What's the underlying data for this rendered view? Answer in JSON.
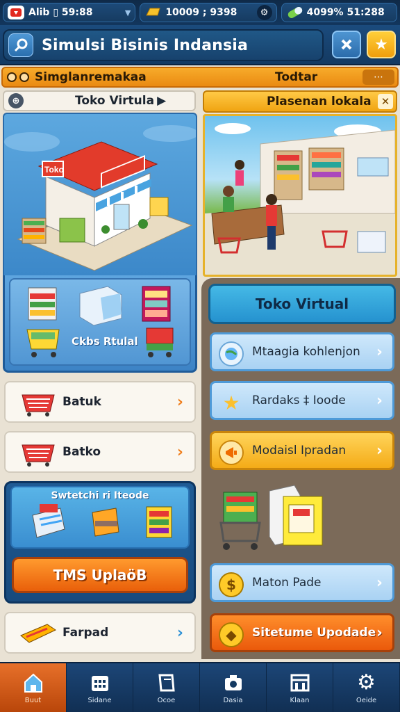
{
  "status": {
    "stat1": "Alib ▯ 59:88",
    "stat2": "10009 ; 9398",
    "stat3": "4099% 51:288"
  },
  "header": {
    "title": "Simulsi Bisinis Indansia"
  },
  "banner": {
    "left_label": "Simglanremakaa",
    "center_label": "Todtar"
  },
  "left": {
    "tab_label": "Toko Virtula",
    "panel_caption": "Ckbs Rtulal",
    "list": [
      {
        "label": "Batuk"
      },
      {
        "label": "Batko"
      }
    ],
    "feature_title": "Swtetchi ri Iteode",
    "feature_button": "TMS UplaöB",
    "last_item": "Farpad"
  },
  "right": {
    "tab_label": "Plasenan lokala",
    "main_button": "Toko Virtual",
    "buttons": [
      {
        "label": "Mtaagia kohlenjon"
      },
      {
        "label": "Rardaks ‡ Ioode"
      },
      {
        "label": "Modaisl Ipradan"
      },
      {
        "label": "Maton Pade"
      },
      {
        "label": "Sitetume Upodade"
      }
    ]
  },
  "nav": {
    "items": [
      {
        "label": "Buut"
      },
      {
        "label": "Sidane"
      },
      {
        "label": "Ocoe"
      },
      {
        "label": "Dasia"
      },
      {
        "label": "Klaan"
      },
      {
        "label": "Oeide"
      }
    ]
  },
  "colors": {
    "accent_orange": "#ea8a12",
    "navy": "#143a62",
    "blue_panel": "#3d83c5"
  }
}
